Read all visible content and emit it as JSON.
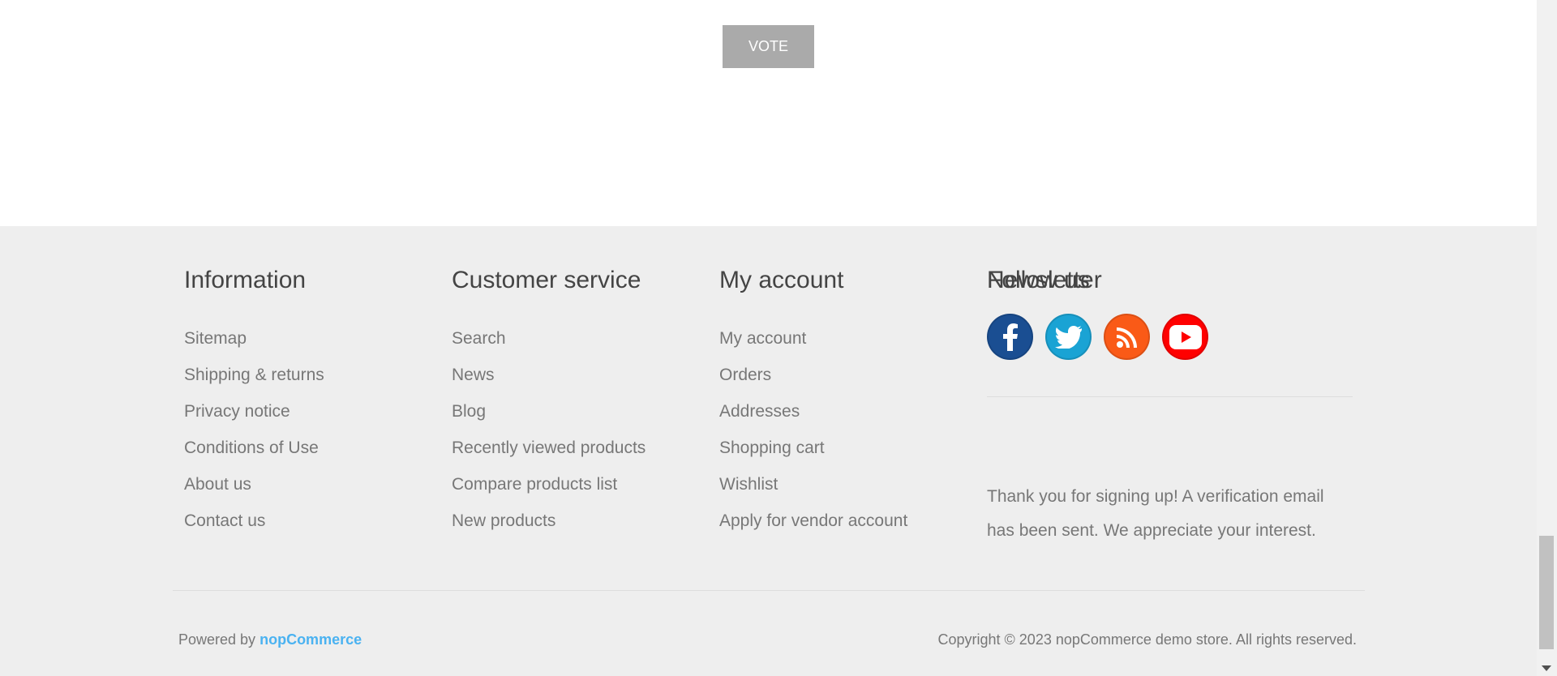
{
  "poll": {
    "vote_label": "VOTE"
  },
  "footer": {
    "information": {
      "title": "Information",
      "links": [
        "Sitemap",
        "Shipping & returns",
        "Privacy notice",
        "Conditions of Use",
        "About us",
        "Contact us"
      ]
    },
    "customer_service": {
      "title": "Customer service",
      "links": [
        "Search",
        "News",
        "Blog",
        "Recently viewed products",
        "Compare products list",
        "New products"
      ]
    },
    "my_account": {
      "title": "My account",
      "links": [
        "My account",
        "Orders",
        "Addresses",
        "Shopping cart",
        "Wishlist",
        "Apply for vendor account"
      ]
    },
    "follow_us": {
      "title": "Follow us",
      "social": [
        {
          "icon": "facebook-icon",
          "color": "#1a4e92"
        },
        {
          "icon": "twitter-icon",
          "color": "#1aa3d4"
        },
        {
          "icon": "rss-icon",
          "color": "#fa5a17"
        },
        {
          "icon": "youtube-icon",
          "color": "#ff0000"
        }
      ]
    },
    "newsletter": {
      "title": "Newsletter",
      "message": "Thank you for signing up! A verification email has been sent. We appreciate your interest."
    },
    "powered_by_prefix": "Powered by",
    "powered_by_link": "nopCommerce",
    "copyright": "Copyright © 2023 nopCommerce demo store. All rights reserved."
  }
}
